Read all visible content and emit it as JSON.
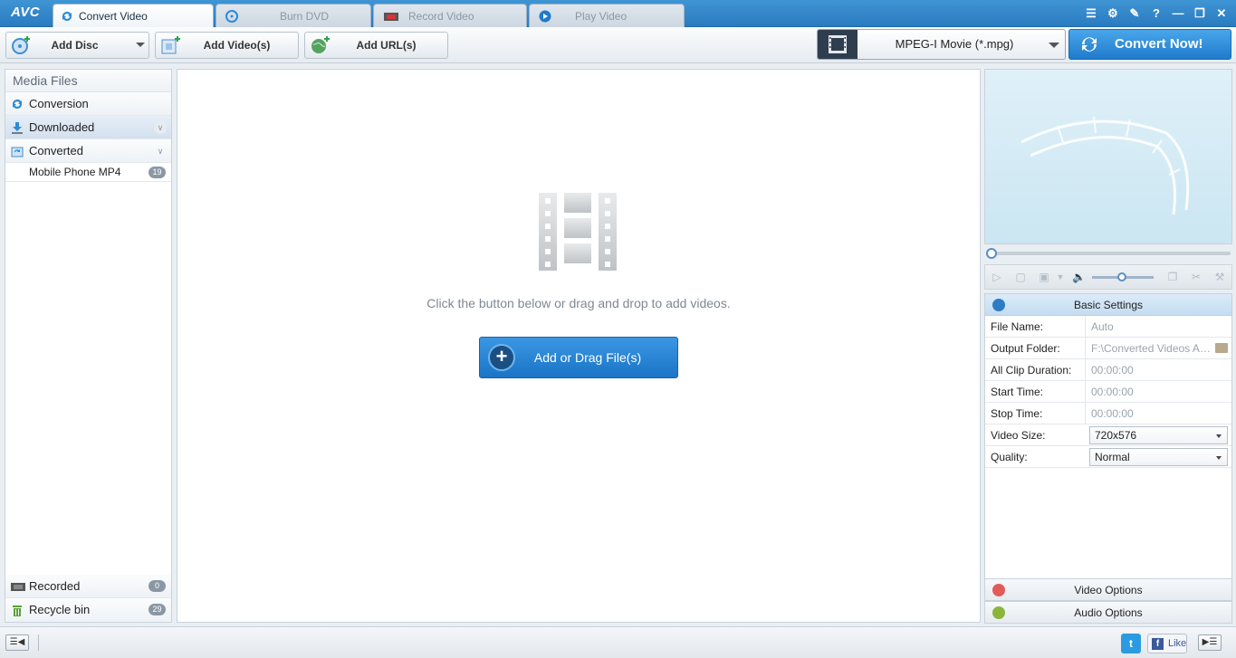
{
  "app": {
    "logo": "AVC"
  },
  "tabs": [
    {
      "label": "Convert Video",
      "active": true,
      "icon": "convert-icon"
    },
    {
      "label": "Burn DVD",
      "active": false,
      "icon": "disc-icon"
    },
    {
      "label": "Record Video",
      "active": false,
      "icon": "record-icon"
    },
    {
      "label": "Play Video",
      "active": false,
      "icon": "play-icon"
    }
  ],
  "window_controls": [
    "menu-icon",
    "gear-icon",
    "skin-icon",
    "help-icon",
    "minimize-icon",
    "restore-icon",
    "close-icon"
  ],
  "window_help_label": "?",
  "toolbar": {
    "add_disc": "Add Disc",
    "add_videos": "Add Video(s)",
    "add_urls": "Add URL(s)",
    "format": "MPEG-I Movie (*.mpg)",
    "convert_now": "Convert Now!"
  },
  "media": {
    "header": "Media Files",
    "items": [
      {
        "label": "Conversion",
        "icon": "conversion-icon"
      },
      {
        "label": "Downloaded",
        "icon": "download-icon",
        "selected": true
      },
      {
        "label": "Converted",
        "icon": "converted-icon"
      }
    ],
    "sub_items": [
      {
        "label": "Mobile Phone MP4",
        "count": "19"
      }
    ],
    "recorded": {
      "label": "Recorded",
      "count": "0"
    },
    "recycle": {
      "label": "Recycle bin",
      "count": "29"
    }
  },
  "center": {
    "hint": "Click the button below or drag and drop to add videos.",
    "add_button": "Add or Drag File(s)",
    "add_plus": "+"
  },
  "settings": {
    "header": "Basic Settings",
    "rows": [
      {
        "label": "File Name:",
        "value": "Auto"
      },
      {
        "label": "Output Folder:",
        "value": "F:\\Converted Videos An..."
      },
      {
        "label": "All Clip Duration:",
        "value": "00:00:00"
      },
      {
        "label": "Start Time:",
        "value": "00:00:00"
      },
      {
        "label": "Stop Time:",
        "value": "00:00:00"
      }
    ],
    "video_size_label": "Video Size:",
    "video_size": "720x576",
    "quality_label": "Quality:",
    "quality": "Normal",
    "video_options": "Video Options",
    "audio_options": "Audio Options"
  },
  "statusbar": {
    "like": "Like",
    "twitter_glyph": "t",
    "facebook_glyph": "f"
  },
  "colors": {
    "accent": "#2a7bc0",
    "convert": "#1f7bcc"
  }
}
